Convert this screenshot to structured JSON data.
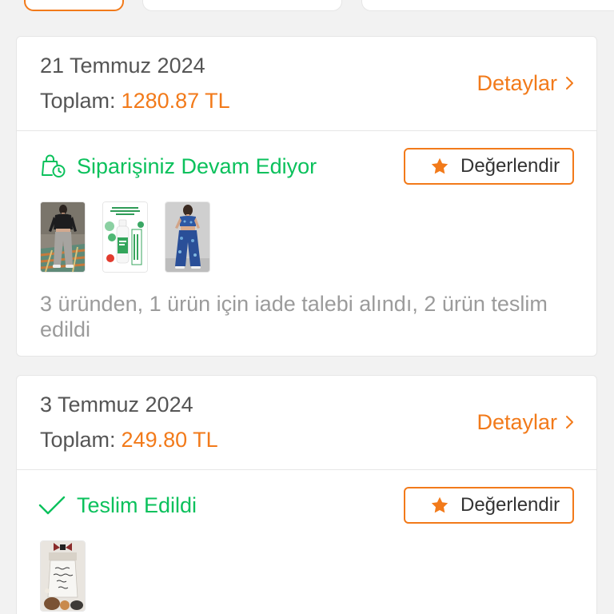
{
  "theme": {
    "accent": "#f27a1a",
    "success": "#0bc15c",
    "background": "#f2f2f2",
    "text": "#555555",
    "muted": "#9b9b9b"
  },
  "orders": [
    {
      "date": "21 Temmuz 2024",
      "total_label": "Toplam:",
      "total_value": "1280.87 TL",
      "details_label": "Detaylar",
      "details_icon": "chevron-right-icon",
      "status_text": "Siparişiniz Devam Ediyor",
      "status_icon": "package-clock-icon",
      "rate_label": "Değerlendir",
      "rate_icon": "star-icon",
      "summary": "3 üründen, 1 ürün için iade talebi alındı, 2 ürün teslim edildi"
    },
    {
      "date": "3 Temmuz 2024",
      "total_label": "Toplam:",
      "total_value": "249.80 TL",
      "details_label": "Detaylar",
      "details_icon": "chevron-right-icon",
      "status_text": "Teslim Edildi",
      "status_icon": "checkmark-icon",
      "rate_label": "Değerlendir",
      "rate_icon": "star-icon"
    }
  ]
}
